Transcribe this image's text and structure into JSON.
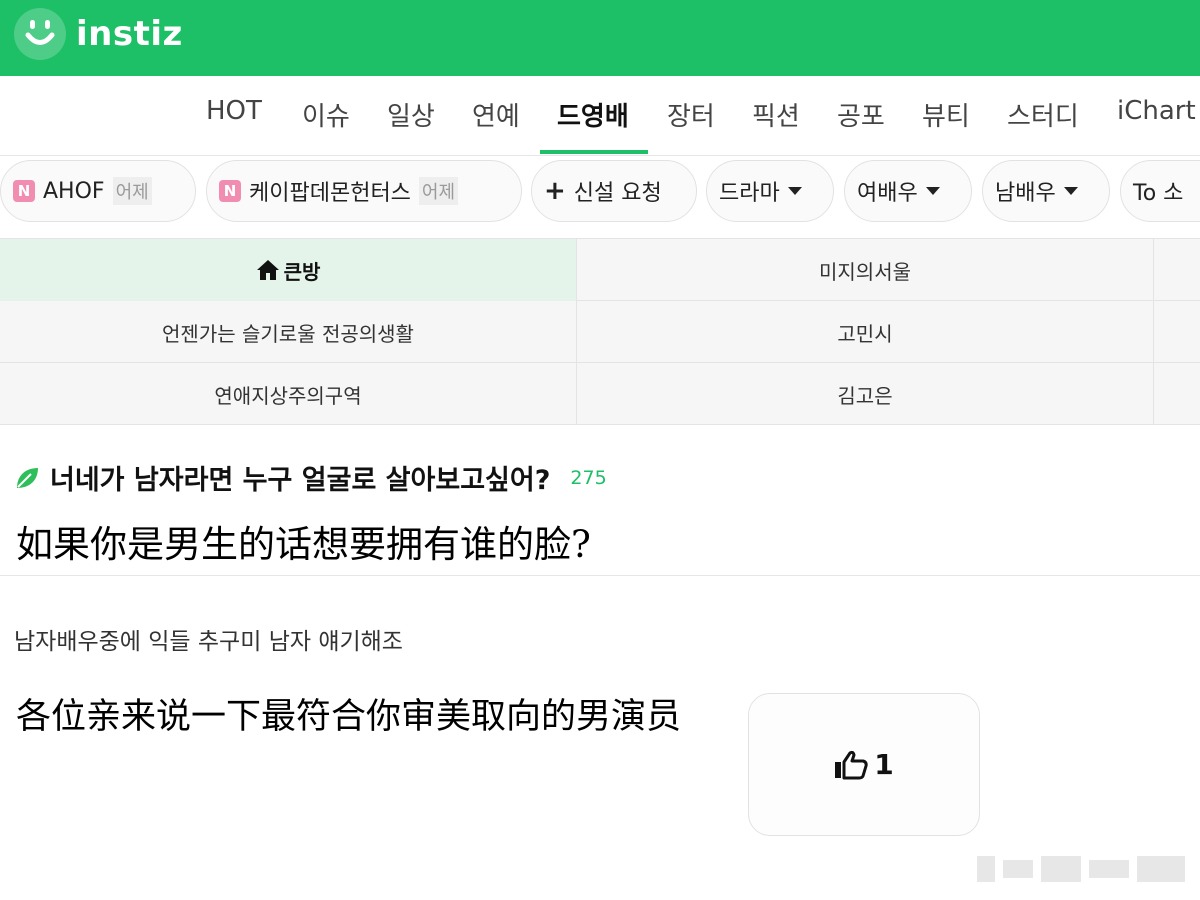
{
  "brand": {
    "name": "instiz",
    "accent": "#1dbf67"
  },
  "categories": [
    {
      "label": "HOT",
      "active": false
    },
    {
      "label": "이슈",
      "active": false
    },
    {
      "label": "일상",
      "active": false
    },
    {
      "label": "연예",
      "active": false
    },
    {
      "label": "드영배",
      "active": true
    },
    {
      "label": "장터",
      "active": false
    },
    {
      "label": "픽션",
      "active": false
    },
    {
      "label": "공포",
      "active": false
    },
    {
      "label": "뷰티",
      "active": false
    },
    {
      "label": "스터디",
      "active": false
    },
    {
      "label": "iChart",
      "active": false
    }
  ],
  "chips": [
    {
      "badge": "N",
      "label": "AHOF",
      "time": "어제"
    },
    {
      "badge": "N",
      "label": "케이팝데몬헌터스",
      "time": "어제"
    },
    {
      "icon": "plus-icon",
      "label": "신설 요청"
    },
    {
      "label": "드라마",
      "dropdown": true
    },
    {
      "label": "여배우",
      "dropdown": true
    },
    {
      "label": "남배우",
      "dropdown": true
    },
    {
      "label": "To 소"
    }
  ],
  "board_table": {
    "rows": [
      [
        "큰방",
        "미지의서울"
      ],
      [
        "언젠가는 슬기로울 전공의생활",
        "고민시"
      ],
      [
        "연애지상주의구역",
        "김고은"
      ]
    ]
  },
  "post": {
    "title": "너네가 남자라면 누구 얼굴로 살아보고싶어?",
    "comment_count": "275",
    "overlay_title": "如果你是男生的话想要拥有谁的脸?",
    "body": "남자배우중에 익들 추구미 남자 얘기해조",
    "overlay_body": "各位亲来说一下最符合你审美取向的男演员",
    "likes": "1"
  }
}
